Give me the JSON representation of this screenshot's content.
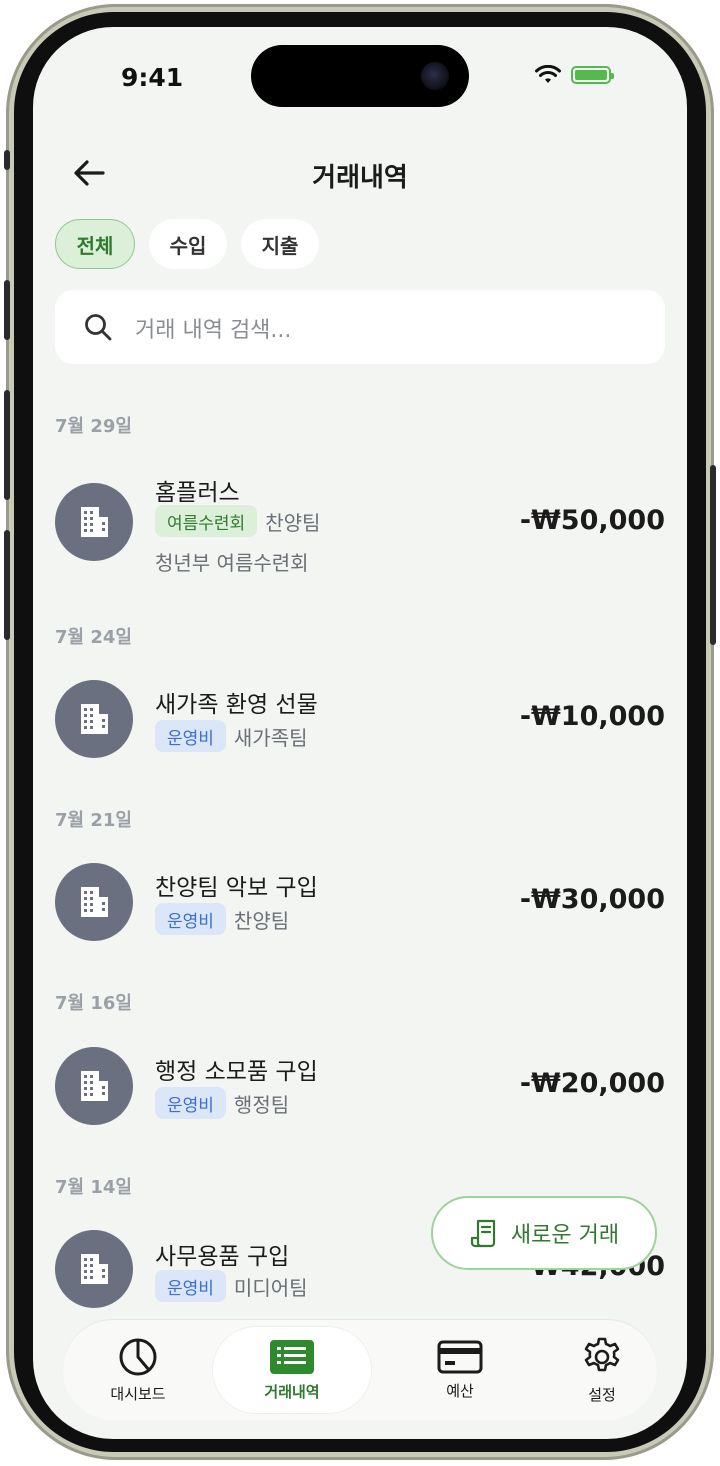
{
  "status_bar": {
    "time": "9:41"
  },
  "header": {
    "title": "거래내역"
  },
  "filters": [
    {
      "label": "전체",
      "active": true
    },
    {
      "label": "수입",
      "active": false
    },
    {
      "label": "지출",
      "active": false
    }
  ],
  "search": {
    "placeholder": "거래 내역 검색..."
  },
  "groups": [
    {
      "date": "7월 29일",
      "items": [
        {
          "title": "홈플러스",
          "tag": "여름수련회",
          "tag_color": "#2f7a2e",
          "team": "찬양팀",
          "description": "청년부 여름수련회",
          "amount": "-₩50,000"
        }
      ]
    },
    {
      "date": "7월 24일",
      "items": [
        {
          "title": "새가족 환영 선물",
          "tag": "운영비",
          "tag_color": "#3a6fd0",
          "team": "새가족팀",
          "amount": "-₩10,000"
        }
      ]
    },
    {
      "date": "7월 21일",
      "items": [
        {
          "title": "찬양팀 악보 구입",
          "tag": "운영비",
          "tag_color": "#3a6fd0",
          "team": "찬양팀",
          "amount": "-₩30,000"
        }
      ]
    },
    {
      "date": "7월 16일",
      "items": [
        {
          "title": "행정 소모품 구입",
          "tag": "운영비",
          "tag_color": "#3a6fd0",
          "team": "행정팀",
          "amount": "-₩20,000"
        }
      ]
    },
    {
      "date": "7월 14일",
      "items": [
        {
          "title": "사무용품 구입",
          "tag": "운영비",
          "tag_color": "#3a6fd0",
          "team": "미디어팀",
          "amount": "-₩42,000"
        }
      ]
    }
  ],
  "fab": {
    "label": "새로운 거래",
    "icon": "receipt-icon"
  },
  "tab_bar": [
    {
      "label": "대시보드",
      "icon": "pie-chart-icon",
      "active": false
    },
    {
      "label": "거래내역",
      "icon": "list-icon",
      "active": true
    },
    {
      "label": "예산",
      "icon": "card-icon",
      "active": false
    },
    {
      "label": "설정",
      "icon": "gear-icon",
      "active": false
    }
  ],
  "colors": {
    "accent": "#2f7a2e",
    "background": "#f3f5f2",
    "avatar": "#6b7080"
  }
}
